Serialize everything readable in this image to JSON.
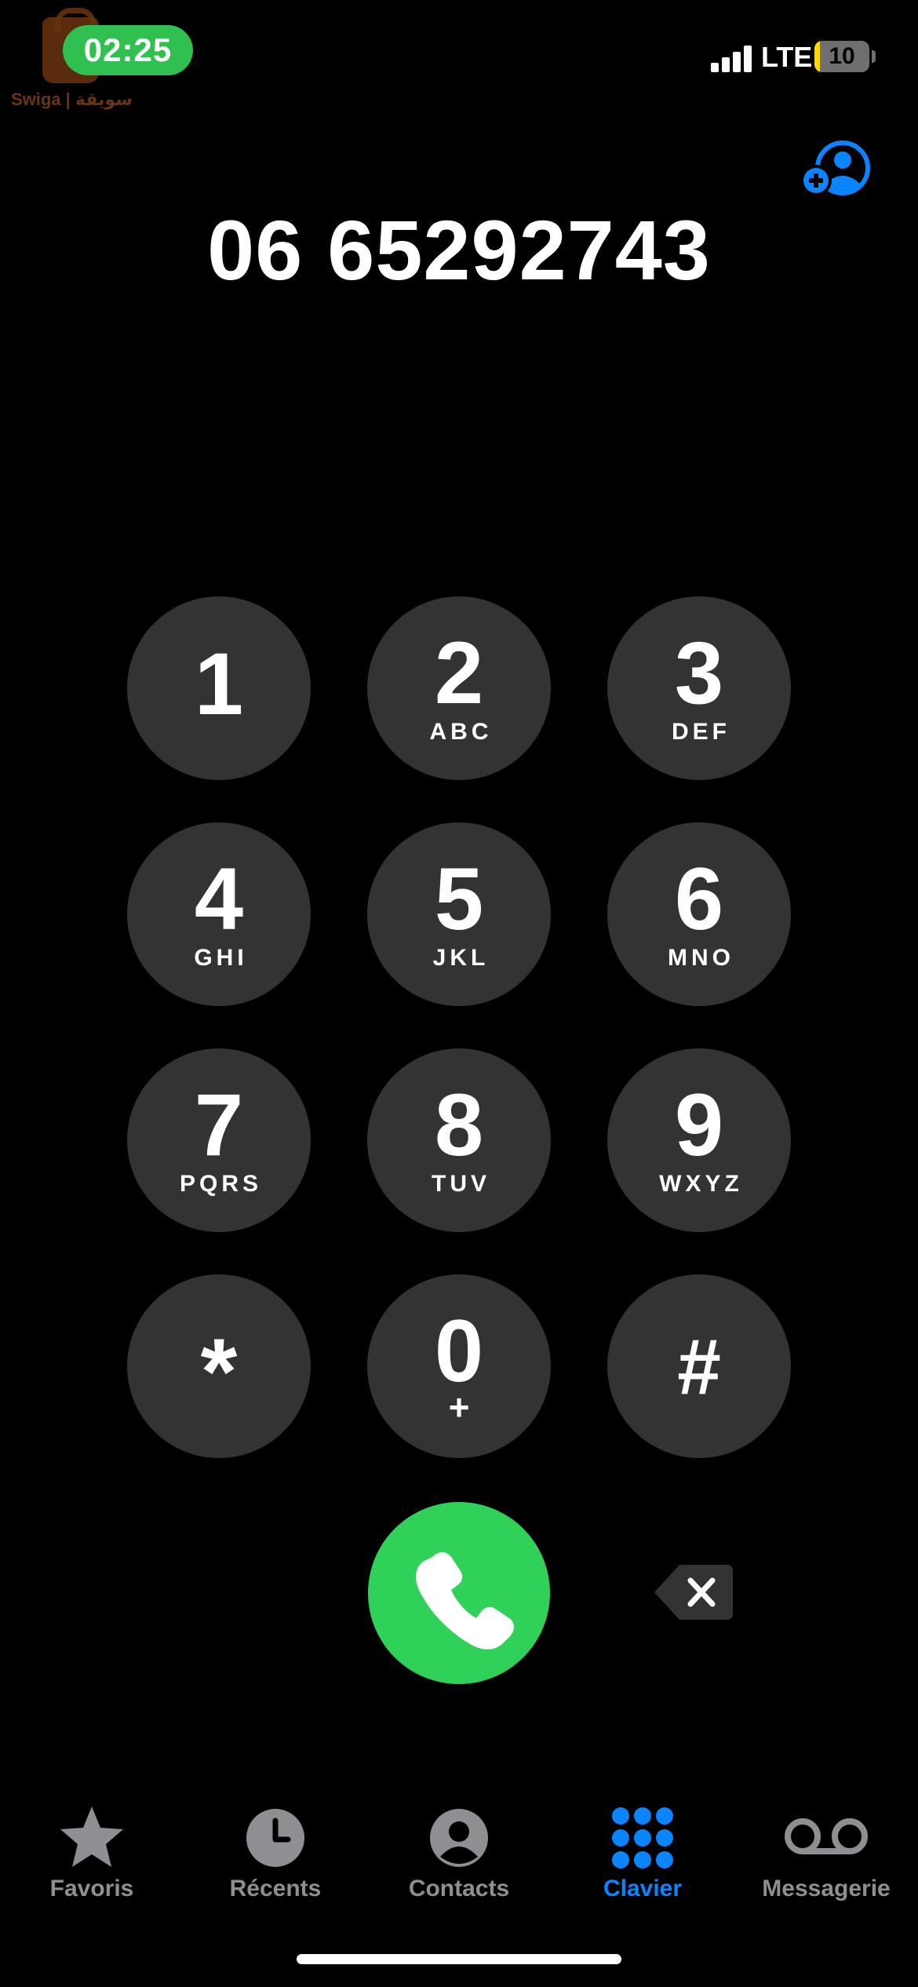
{
  "status_bar": {
    "time": "02:25",
    "network": "LTE",
    "battery_level": "10",
    "battery_fraction": 0.1,
    "time_pill_color": "#30c04f",
    "watermark_text": "Swiga | سويقة"
  },
  "dialer": {
    "number": "06 65292743",
    "add_contact_icon": "person-add-icon",
    "accent_color": "#0a84ff"
  },
  "keypad": {
    "keys": [
      {
        "digit": "1",
        "letters": ""
      },
      {
        "digit": "2",
        "letters": "ABC"
      },
      {
        "digit": "3",
        "letters": "DEF"
      },
      {
        "digit": "4",
        "letters": "GHI"
      },
      {
        "digit": "5",
        "letters": "JKL"
      },
      {
        "digit": "6",
        "letters": "MNO"
      },
      {
        "digit": "7",
        "letters": "PQRS"
      },
      {
        "digit": "8",
        "letters": "TUV"
      },
      {
        "digit": "9",
        "letters": "WXYZ"
      },
      {
        "digit": "*",
        "letters": ""
      },
      {
        "digit": "0",
        "letters": "+"
      },
      {
        "digit": "#",
        "letters": ""
      }
    ],
    "call_icon": "phone-icon",
    "call_color": "#30d158",
    "delete_icon": "backspace-icon"
  },
  "tab_bar": {
    "active_tab": "Clavier",
    "tabs": [
      {
        "label": "Favoris",
        "icon": "star-icon"
      },
      {
        "label": "Récents",
        "icon": "clock-icon"
      },
      {
        "label": "Contacts",
        "icon": "person-circle-icon"
      },
      {
        "label": "Clavier",
        "icon": "keypad-icon"
      },
      {
        "label": "Messagerie",
        "icon": "voicemail-icon"
      }
    ]
  }
}
